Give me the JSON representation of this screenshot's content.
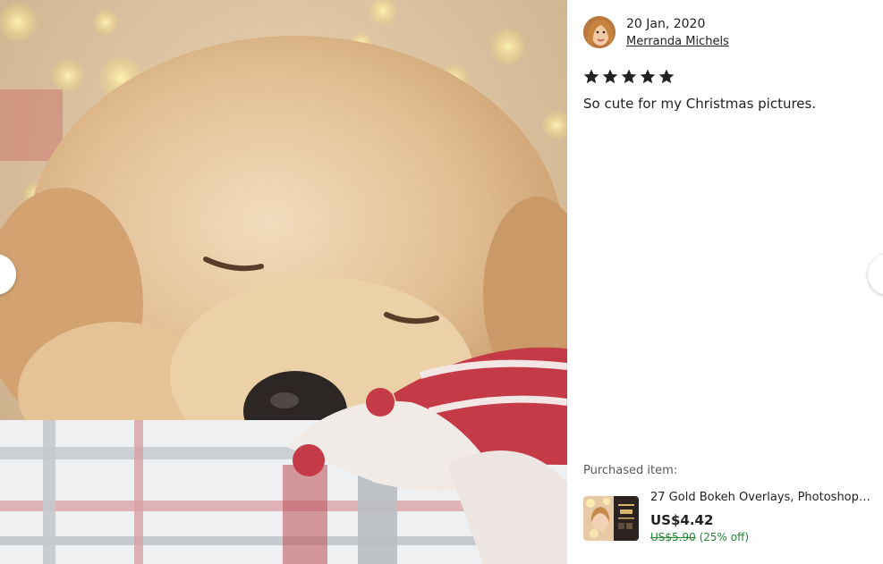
{
  "review": {
    "date": "20 Jan, 2020",
    "reviewer_name": "Merranda Michels",
    "rating": 5,
    "max_rating": 5,
    "text": "So cute for my Christmas pictures."
  },
  "purchase": {
    "label": "Purchased item:",
    "item_title": "27 Gold Bokeh Overlays, Photoshop O...",
    "price": "US$4.42",
    "original_price": "US$5.90",
    "discount": "(25% off)"
  },
  "colors": {
    "discount_green": "#258635",
    "star_black": "#222222"
  },
  "icons": {
    "prev": "chevron-left-icon",
    "next": "chevron-right-icon",
    "star": "star-icon"
  }
}
